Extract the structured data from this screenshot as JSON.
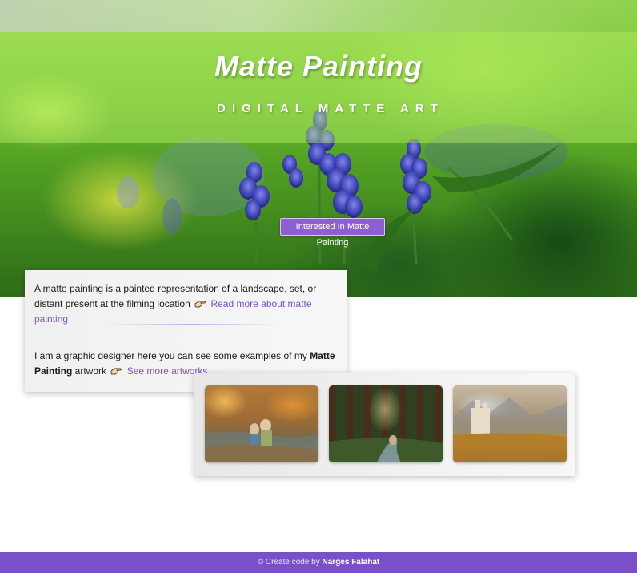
{
  "hero": {
    "title": "Matte Painting",
    "subtitle": "DIGITAL MATTE ART",
    "cta_label": "Interested In Matte Painting"
  },
  "info": {
    "para1_text": "A matte painting is a painted representation of a landscape, set, or distant present at the filming location",
    "para1_link": "Read more about matte painting",
    "para2_text_a": "I am a graphic designer here you can see some examples of my ",
    "para2_bold": "Matte Painting",
    "para2_text_b": " artwork",
    "para2_link": "See more artworks",
    "link_icon": "pointing-hand-icon"
  },
  "gallery": {
    "items": [
      {
        "name": "gallery-artwork-1"
      },
      {
        "name": "gallery-artwork-2"
      },
      {
        "name": "gallery-artwork-3"
      }
    ]
  },
  "footer": {
    "prefix": "© Create code by ",
    "author": "Narges Falahat"
  },
  "colors": {
    "accent": "#7a50c8",
    "link": "#7b53c8",
    "button": "#8d5fd3"
  }
}
